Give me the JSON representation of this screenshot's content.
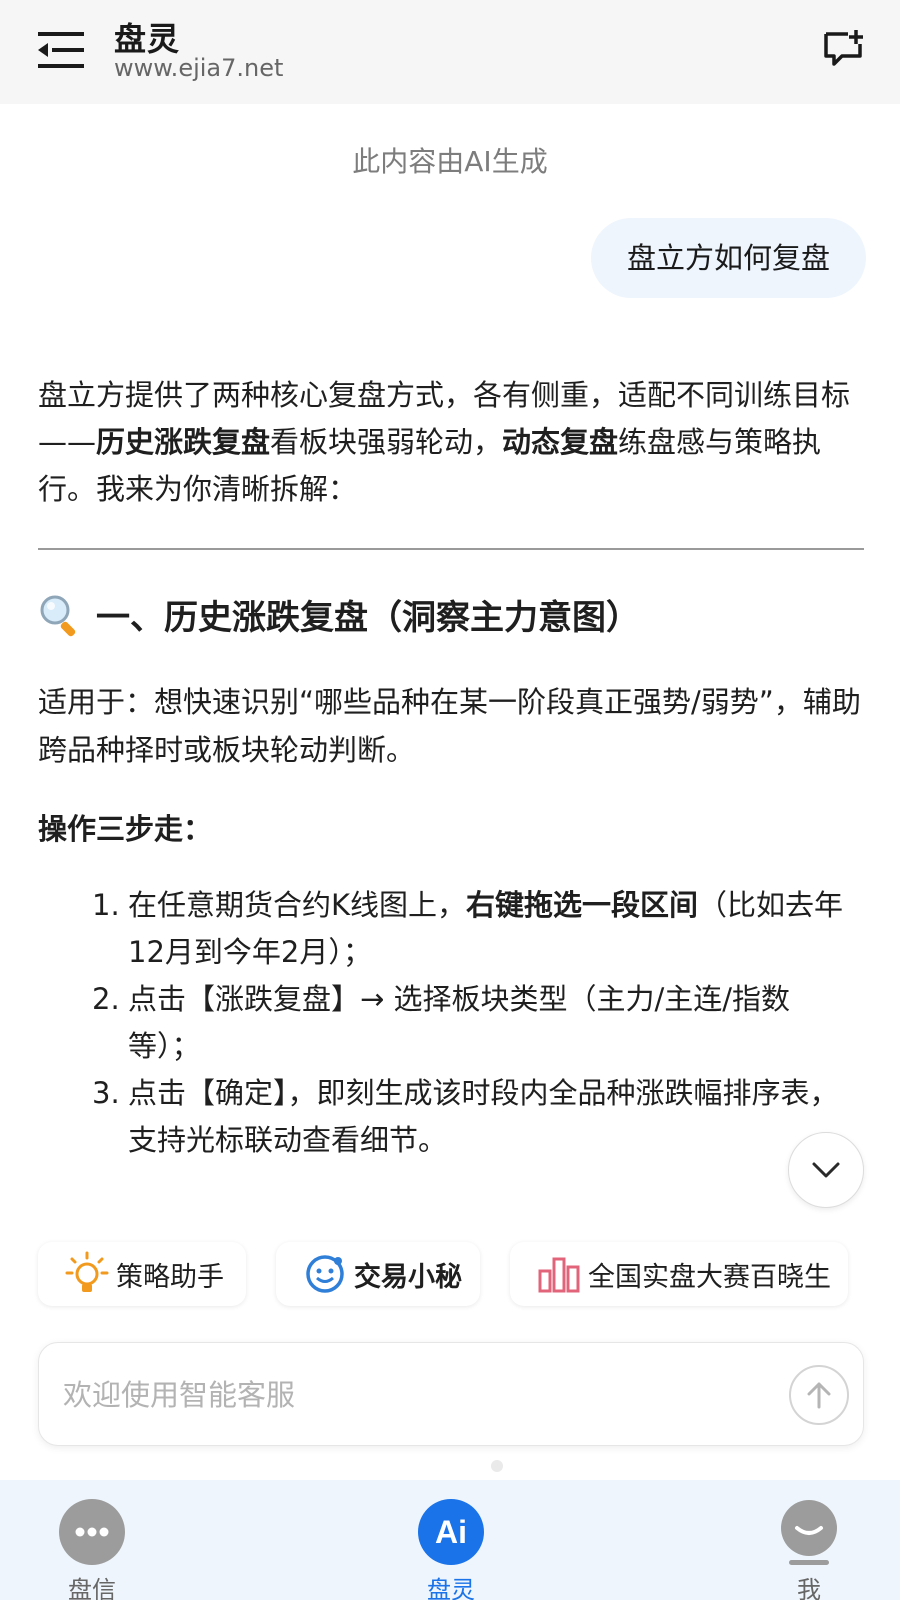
{
  "header": {
    "title": "盘灵",
    "subtitle": "www.ejia7.net"
  },
  "notice": "此内容由AI生成",
  "user_message": "盘立方如何复盘",
  "answer": {
    "intro_1": "盘立方提供了两种核心复盘方式，各有侧重，适配不同训练目标——",
    "intro_bold_1": "历史涨跌复盘",
    "intro_2": "看板块强弱轮动，",
    "intro_bold_2": "动态复盘",
    "intro_3": "练盘感与策略执行。我来为你清晰拆解：",
    "section_title": "一、历史涨跌复盘（洞察主力意图）",
    "applies": "适用于：想快速识别“哪些品种在某一阶段真正强势/弱势”，辅助跨品种择时或板块轮动判断。",
    "steps_heading": "操作三步走：",
    "steps": [
      {
        "num": "1.",
        "pre": "在任意期货合约K线图上，",
        "bold": "右键拖选一段区间",
        "post": "（比如去年12月到今年2月）；"
      },
      {
        "num": "2.",
        "pre": "点击【涨跌复盘】→ 选择板块类型（主力/主连/指数等）；",
        "bold": "",
        "post": ""
      },
      {
        "num": "3.",
        "pre": "点击【确定】，即刻生成该时段内全品种涨跌幅排序表，支持光标联动查看细节。",
        "bold": "",
        "post": ""
      }
    ]
  },
  "quick_tools": [
    {
      "label": "策略助手",
      "icon": "lightbulb-icon"
    },
    {
      "label": "交易小秘",
      "icon": "smiley-bot-icon"
    },
    {
      "label": "全国实盘大赛百晓生",
      "icon": "bar-chart-icon"
    }
  ],
  "input": {
    "placeholder": "欢迎使用智能客服"
  },
  "nav": {
    "left": "盘信",
    "mid": "盘灵",
    "mid_icon_text": "Ai",
    "right": "我"
  },
  "colors": {
    "accent": "#1a73e8",
    "bubble": "#eef5fd",
    "nav_bg": "#eef5fc"
  }
}
